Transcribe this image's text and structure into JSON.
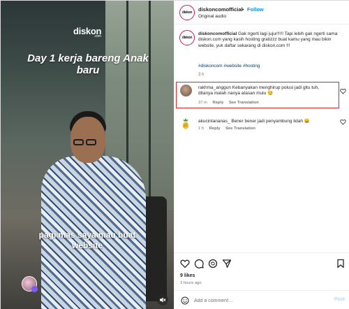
{
  "video": {
    "brand": "diskon",
    "brand_sub": ".com",
    "overlay_title": "Day 1 kerja bareng Anak baru",
    "caption": "pagi mas saya mau buat website"
  },
  "header": {
    "username": "diskoncomofficial",
    "separator": "•",
    "follow_label": "Follow",
    "audio": "Original audio",
    "avatar_text": "diskon"
  },
  "post_caption": {
    "username": "diskoncomofficial",
    "text": " Gak ngerti lagi jujur!!!!! Tapi lebih gak ngerti sama diskon.com yang kasih hosting gratizzz buat kamu yang mau bikin website, yuk daftar sekarang di diskon.com !!!",
    "hashtags": "#diskoncom #website #hosting",
    "time": "3 h"
  },
  "comments": [
    {
      "username": "rakhma_anggun",
      "text": " Kebanyakan menghirup polusi jadi gitu tuh, ditanya malah nanya atasan mulu 😏",
      "time": "37 m",
      "reply": "Reply",
      "see_translation": "See Translation"
    },
    {
      "username": "akucintananas_",
      "text": " Bener bener jadi penyambung lidah 😄",
      "time": "1 h",
      "reply": "Reply",
      "see_translation": "See Translation"
    }
  ],
  "stats": {
    "likes": "9 likes",
    "posted": "3 hours ago"
  },
  "add_comment": {
    "placeholder": "Add a comment…",
    "post_label": "Post"
  },
  "colors": {
    "accent": "#0095f6",
    "highlight": "#e0232b",
    "hashtag": "#00376b",
    "muted": "#737373"
  }
}
